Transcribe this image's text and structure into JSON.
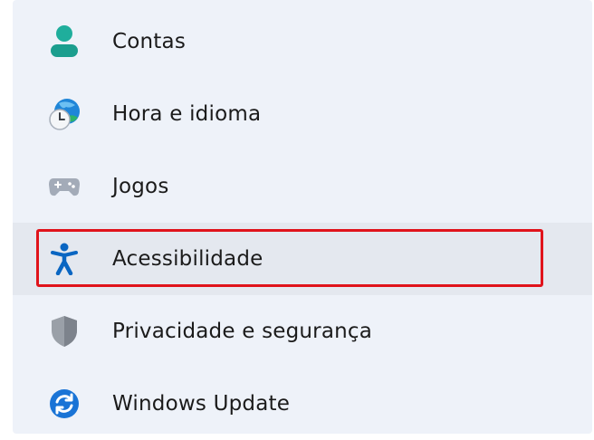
{
  "nav": {
    "items": [
      {
        "label": "Contas",
        "icon": "person-icon",
        "color": "#1fae9c"
      },
      {
        "label": "Hora e idioma",
        "icon": "globe-clock-icon",
        "color": "#1f86d8"
      },
      {
        "label": "Jogos",
        "icon": "gamepad-icon",
        "color": "#8a94a6"
      },
      {
        "label": "Acessibilidade",
        "icon": "accessibility-icon",
        "color": "#0a66c2",
        "selected": true
      },
      {
        "label": "Privacidade e segurança",
        "icon": "shield-icon",
        "color": "#8c9199"
      },
      {
        "label": "Windows Update",
        "icon": "update-icon",
        "color": "#1a74d6"
      }
    ]
  },
  "highlight": {
    "color": "#e0131b"
  }
}
